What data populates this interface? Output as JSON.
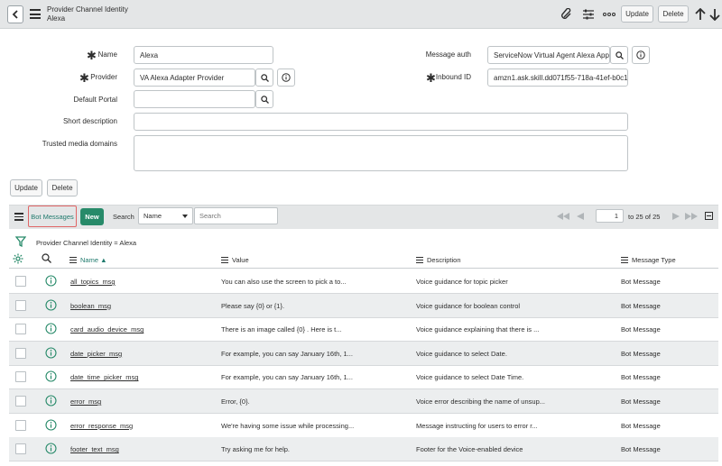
{
  "header": {
    "title_line1": "Provider Channel Identity",
    "title_line2": "Alexa",
    "update_label": "Update",
    "delete_label": "Delete"
  },
  "form": {
    "name_label": "Name",
    "name_value": "Alexa",
    "provider_label": "Provider",
    "provider_value": "VA Alexa Adapter Provider",
    "default_portal_label": "Default Portal",
    "default_portal_value": "",
    "short_description_label": "Short description",
    "short_description_value": "",
    "trusted_media_label": "Trusted media domains",
    "trusted_media_value": "",
    "message_auth_label": "Message auth",
    "message_auth_value": "ServiceNow Virtual Agent Alexa App",
    "inbound_id_label": "Inbound ID",
    "inbound_id_value": "amzn1.ask.skill.dd071f55-718a-41ef-b0c1-"
  },
  "form_actions": {
    "update_label": "Update",
    "delete_label": "Delete"
  },
  "related_list": {
    "tab_label": "Bot Messages",
    "new_label": "New",
    "search_label": "Search",
    "search_field_selected": "Name",
    "search_placeholder": "Search",
    "page_current": "1",
    "page_range_text": "to 25 of 25",
    "breadcrumb": "Provider Channel Identity = Alexa"
  },
  "table": {
    "columns": [
      "Name ▲",
      "Value",
      "Description",
      "Message Type"
    ],
    "rows": [
      {
        "name": "all_topics_msg",
        "value": "You can also use the screen to pick a to...",
        "description": "Voice guidance for topic picker",
        "type": "Bot Message"
      },
      {
        "name": "boolean_msg",
        "value": "Please say {0} or {1}.",
        "description": "Voice guidance for boolean control",
        "type": "Bot Message"
      },
      {
        "name": "card_audio_device_msg",
        "value": "There is an image called {0} . Here is t...",
        "description": "Voice guidance explaining that there is ...",
        "type": "Bot Message"
      },
      {
        "name": "date_picker_msg",
        "value": "For example, you can say January 16th, 1...",
        "description": "Voice guidance to select Date.",
        "type": "Bot Message"
      },
      {
        "name": "date_time_picker_msg",
        "value": "For example, you can say January 16th, 1...",
        "description": "Voice guidance to select Date Time.",
        "type": "Bot Message"
      },
      {
        "name": "error_msg",
        "value": "Error, {0}.",
        "description": "Voice error describing the name of unsup...",
        "type": "Bot Message"
      },
      {
        "name": "error_response_msg",
        "value": "We're having some issue while processing...",
        "description": "Message instructing for users to error r...",
        "type": "Bot Message"
      },
      {
        "name": "footer_text_msg",
        "value": "Try asking me for help.",
        "description": "Footer for the Voice-enabled device",
        "type": "Bot Message"
      }
    ]
  },
  "colors": {
    "header_bg": "#e4e6e7",
    "new_button": "#278a69",
    "tab_highlight": "#e06666",
    "tab_text": "#1f7a6d",
    "info_icon": "#278a69",
    "filter_icon": "#278a69"
  }
}
